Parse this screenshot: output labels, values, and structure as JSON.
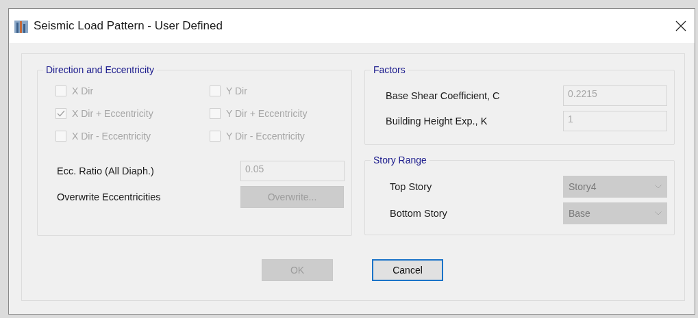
{
  "window": {
    "title": "Seismic Load Pattern - User Defined"
  },
  "direction_and_eccentricity": {
    "title": "Direction and Eccentricity",
    "checkboxes": [
      {
        "label": "X Dir",
        "checked": false,
        "disabled": true
      },
      {
        "label": "Y Dir",
        "checked": false,
        "disabled": true
      },
      {
        "label": "X Dir + Eccentricity",
        "checked": true,
        "disabled": true
      },
      {
        "label": "Y Dir + Eccentricity",
        "checked": false,
        "disabled": true
      },
      {
        "label": "X Dir - Eccentricity",
        "checked": false,
        "disabled": true
      },
      {
        "label": "Y Dir - Eccentricity",
        "checked": false,
        "disabled": true
      }
    ],
    "rows": [
      {
        "kind": "field",
        "label": "Ecc. Ratio (All Diaph.)",
        "value": "0.05",
        "disabled": true
      },
      {
        "kind": "button",
        "label": "Overwrite Eccentricities",
        "button": "Overwrite...",
        "disabled": true
      }
    ]
  },
  "factors": {
    "title": "Factors",
    "rows": [
      {
        "kind": "field",
        "label": "Base Shear Coefficient, C",
        "value": "0.2215",
        "disabled": true
      },
      {
        "kind": "field",
        "label": "Building Height Exp., K",
        "value": "1",
        "disabled": true
      }
    ]
  },
  "story_range": {
    "title": "Story Range",
    "rows": [
      {
        "kind": "combo",
        "label": "Top Story",
        "value": "Story4",
        "disabled": true
      },
      {
        "kind": "combo",
        "label": "Bottom Story",
        "value": "Base",
        "disabled": true
      }
    ]
  },
  "buttons": [
    {
      "label": "OK",
      "disabled": true,
      "default": false
    },
    {
      "label": "Cancel",
      "disabled": false,
      "default": true
    }
  ]
}
